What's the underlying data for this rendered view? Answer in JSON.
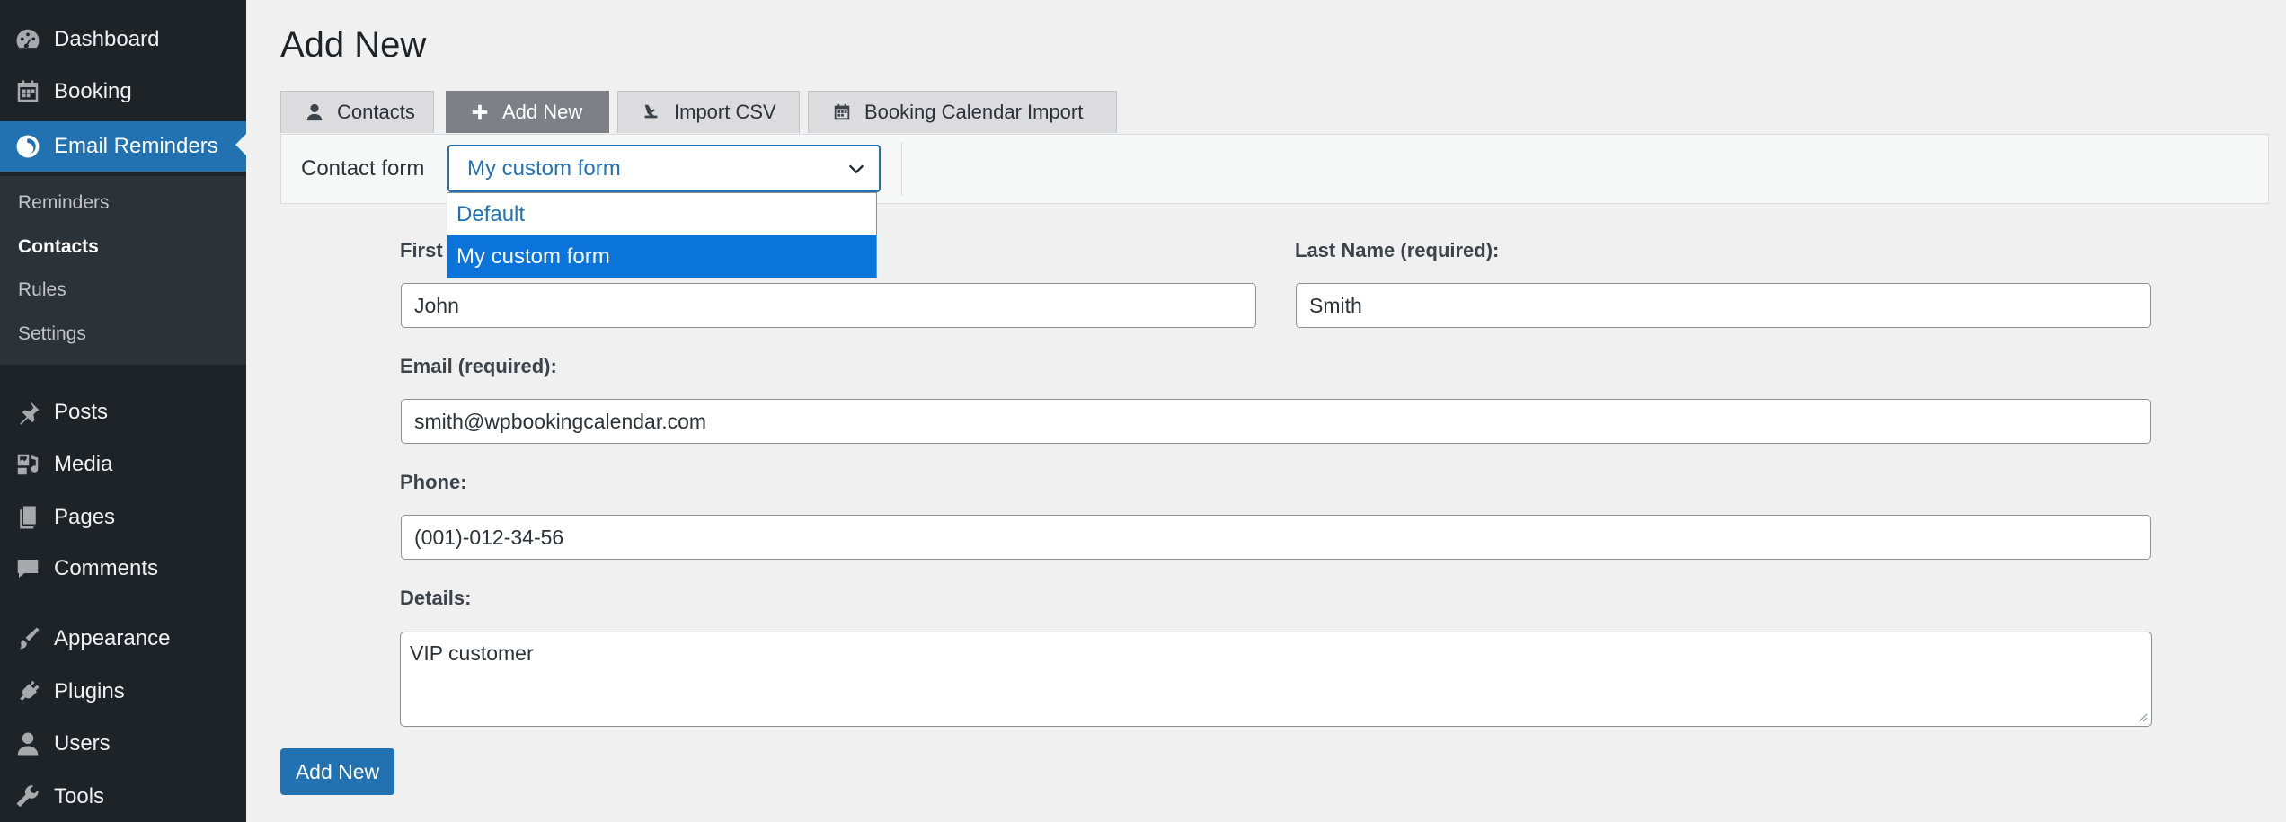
{
  "sidebar": {
    "items": [
      {
        "label": "Dashboard",
        "icon": "dashboard-icon"
      },
      {
        "label": "Booking",
        "icon": "booking-calendar-icon"
      },
      {
        "label": "Email Reminders",
        "icon": "email-reminders-icon",
        "active": true
      },
      {
        "label": "Posts",
        "icon": "pin-icon"
      },
      {
        "label": "Media",
        "icon": "media-icon"
      },
      {
        "label": "Pages",
        "icon": "pages-icon"
      },
      {
        "label": "Comments",
        "icon": "comment-icon"
      },
      {
        "label": "Appearance",
        "icon": "brush-icon"
      },
      {
        "label": "Plugins",
        "icon": "plug-icon"
      },
      {
        "label": "Users",
        "icon": "user-icon"
      },
      {
        "label": "Tools",
        "icon": "wrench-icon"
      }
    ],
    "submenu": [
      {
        "label": "Reminders"
      },
      {
        "label": "Contacts",
        "current": true
      },
      {
        "label": "Rules"
      },
      {
        "label": "Settings"
      }
    ]
  },
  "page": {
    "title": "Add New"
  },
  "tabs": [
    {
      "label": "Contacts",
      "icon": "user-icon"
    },
    {
      "label": "Add New",
      "icon": "plus-icon",
      "active": true
    },
    {
      "label": "Import CSV",
      "icon": "import-icon"
    },
    {
      "label": "Booking Calendar Import",
      "icon": "calendar-icon"
    }
  ],
  "contact_form": {
    "label": "Contact form",
    "selected": "My custom form",
    "options": [
      "Default",
      "My custom form"
    ]
  },
  "fields": {
    "first_name": {
      "label": "First",
      "value": "John"
    },
    "last_name": {
      "label": "Last Name (required):",
      "value": "Smith"
    },
    "email": {
      "label": "Email (required):",
      "value": "smith@wpbookingcalendar.com"
    },
    "phone": {
      "label": "Phone:",
      "value": "(001)-012-34-56"
    },
    "details": {
      "label": "Details:",
      "value": "VIP customer"
    }
  },
  "submit_label": "Add New",
  "colors": {
    "accent": "#2271b1",
    "sidebar_bg": "#1d2327",
    "submenu_bg": "#2c3338",
    "selected_option": "#0a74da",
    "active_tab": "#7e8087"
  }
}
